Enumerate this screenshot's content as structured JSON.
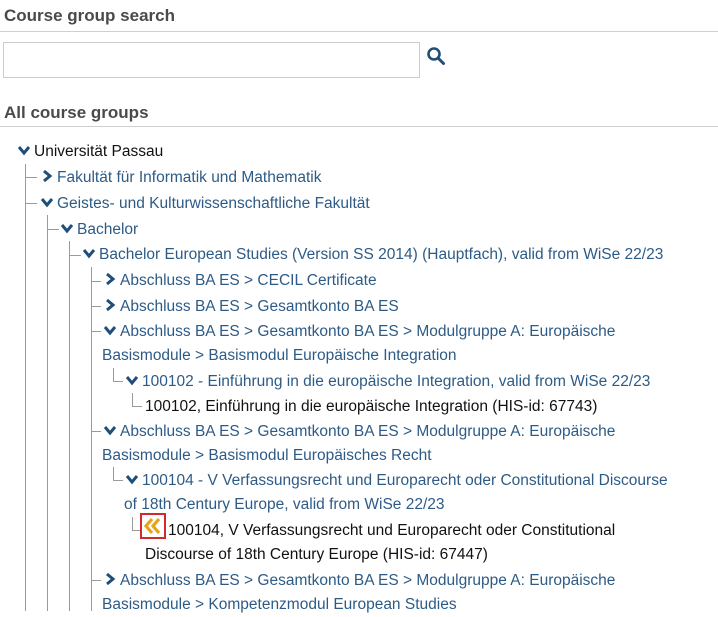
{
  "search": {
    "heading": "Course group search",
    "value": "",
    "placeholder": ""
  },
  "tree_heading": "All course groups",
  "tree": {
    "root": "Universität Passau",
    "fak_inf": "Fakultät für Informatik und Mathematik",
    "fak_geist": "Geistes- und Kulturwissenschaftliche Fakultät",
    "bachelor": "Bachelor",
    "ba_es": "Bachelor European Studies (Version SS 2014) (Hauptfach), valid from WiSe 22/23",
    "cecil": "Abschluss BA ES > CECIL Certificate",
    "gesamtkonto": "Abschluss BA ES > Gesamtkonto BA ES",
    "modA_integration_l1": "Abschluss BA ES > Gesamtkonto BA ES > Modulgruppe A: Europäische",
    "modA_integration_l2": "Basismodule > Basismodul Europäische Integration",
    "m100102_group": "100102 - Einführung in die europäische Integration, valid from WiSe 22/23",
    "m100102_course": "100102, Einführung in die europäische Integration (HIS-id: 67743)",
    "modA_recht_l1": "Abschluss BA ES > Gesamtkonto BA ES > Modulgruppe A: Europäische",
    "modA_recht_l2": "Basismodule > Basismodul Europäisches Recht",
    "m100104_group_l1": "100104 - V Verfassungsrecht und Europarecht oder Constitutional Discourse",
    "m100104_group_l2": "of 18th Century Europe, valid from WiSe 22/23",
    "m100104_course_l1": "100104, V Verfassungsrecht und Europarecht oder Constitutional",
    "m100104_course_l2": "Discourse of 18th Century Europe (HIS-id: 67447)",
    "modA_kompetenz_l1": "Abschluss BA ES > Gesamtkonto BA ES > Modulgruppe A: Europäische",
    "modA_kompetenz_l2": "Basismodule > Kompetenzmodul European Studies"
  },
  "colors": {
    "link": "#2d5b86",
    "chevron": "#1f4e79",
    "add_icon": "#e8a317",
    "highlight_border": "#d22a2a"
  },
  "icons": {
    "search": "search-icon",
    "expanded": "chevron-down-icon",
    "collapsed": "chevron-right-icon",
    "add": "double-chevron-left-icon"
  }
}
